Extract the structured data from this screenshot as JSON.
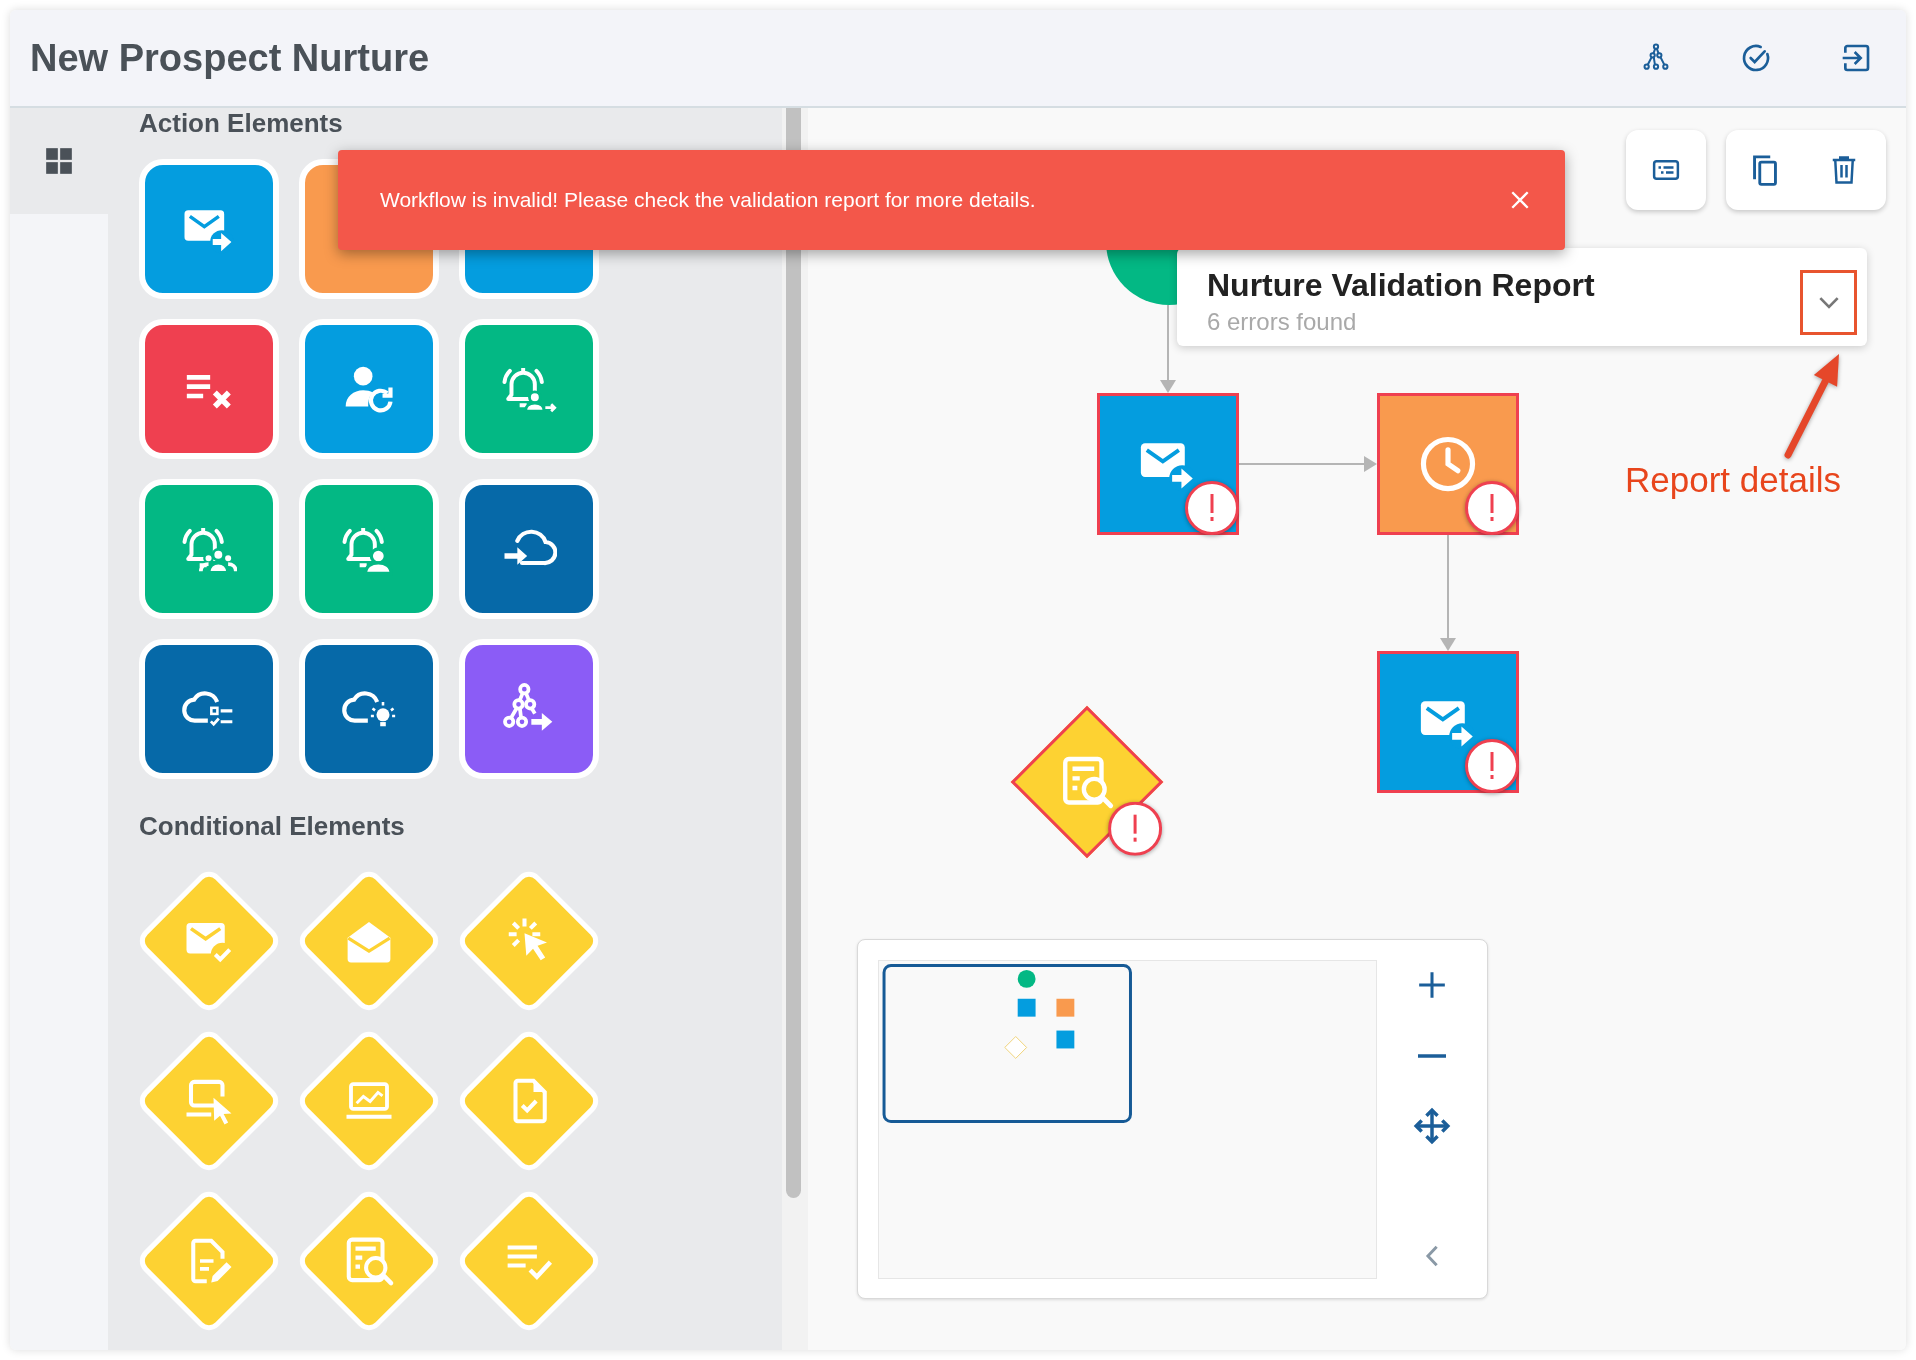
{
  "window": {
    "title": "New Prospect Nurture"
  },
  "sidebar": {
    "tabs": [
      {
        "selected": true
      }
    ]
  },
  "palette": {
    "sections": [
      {
        "kind": "tiles",
        "title": "Action Elements",
        "items": [
          {
            "color": "#049ddf"
          },
          {
            "color": "#f99a4e"
          },
          {
            "color": "#049ddf"
          },
          {
            "color": "#ef4050"
          },
          {
            "color": "#049ddf"
          },
          {
            "color": "#03b884"
          },
          {
            "color": "#03b884"
          },
          {
            "color": "#03b884"
          },
          {
            "color": "#0669a8"
          },
          {
            "color": "#0669a8"
          },
          {
            "color": "#0669a8"
          },
          {
            "color": "#8b5cf6"
          }
        ]
      },
      {
        "kind": "diamonds",
        "title": "Conditional Elements"
      }
    ]
  },
  "toast": {
    "message": "Workflow is invalid! Please check the validation report for more details."
  },
  "validation_report": {
    "title": "Nurture Validation Report",
    "summary": "6 errors found",
    "expanded": false
  },
  "annotation": {
    "text": "Report details"
  },
  "canvas": {
    "nodes": [
      {
        "kind": "start",
        "color": "#03b884",
        "error": false
      },
      {
        "kind": "action",
        "color": "#049ddf",
        "error": true
      },
      {
        "kind": "action",
        "color": "#f99a4e",
        "error": true
      },
      {
        "kind": "action",
        "color": "#049ddf",
        "error": true
      },
      {
        "kind": "condition",
        "color": "#fdd232",
        "error": true
      }
    ]
  }
}
